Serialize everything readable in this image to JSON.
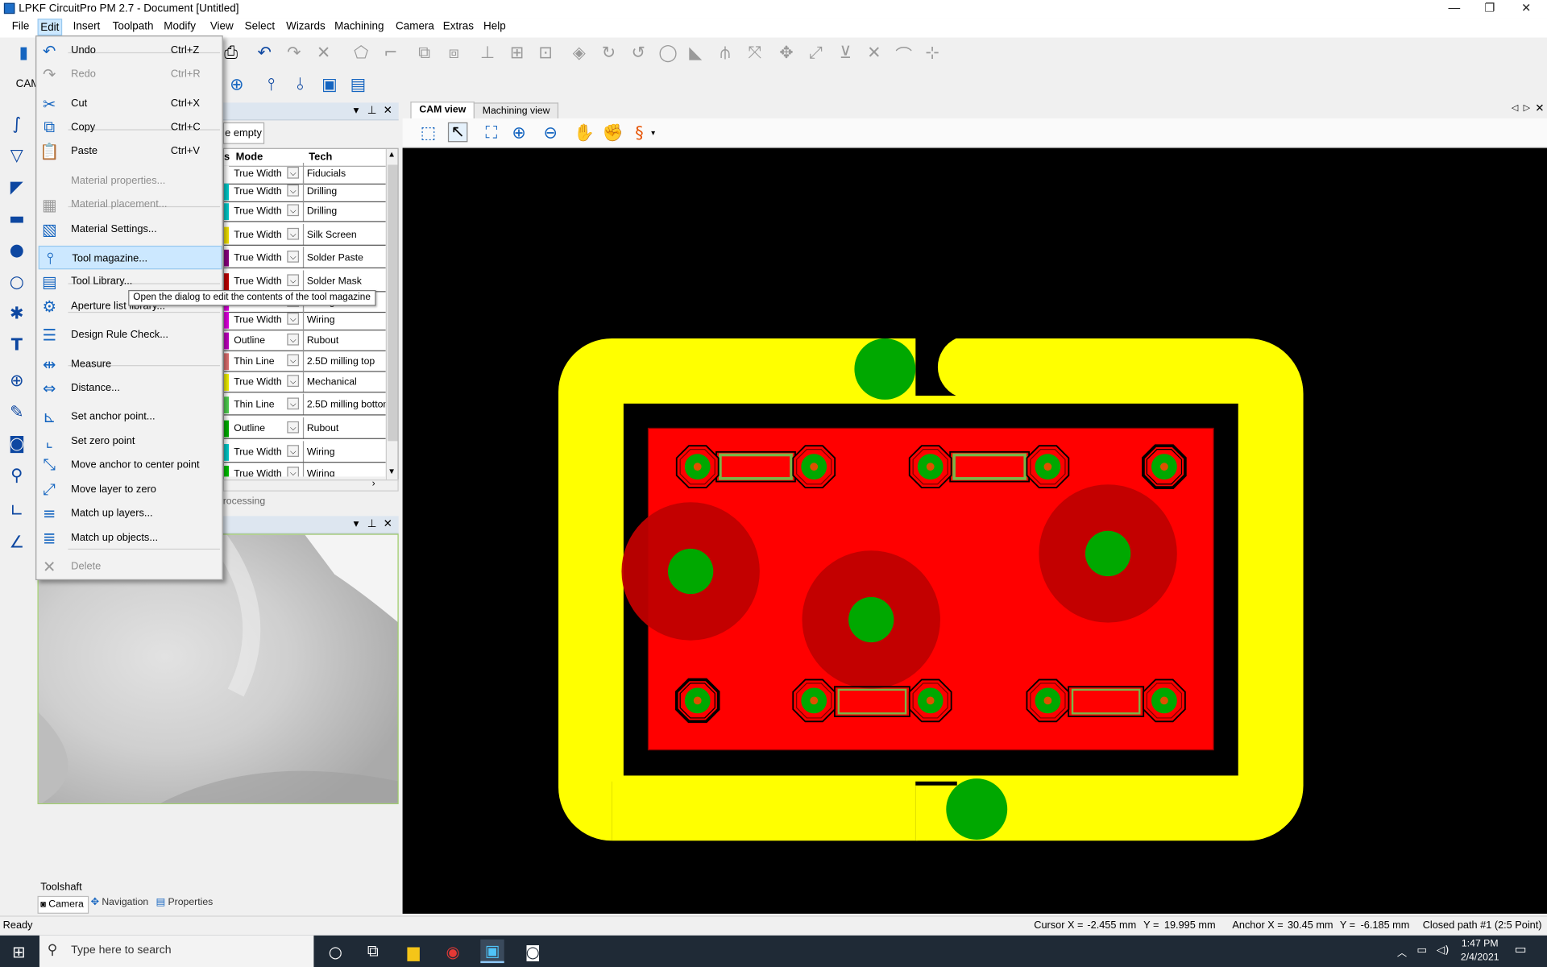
{
  "window": {
    "title": "LPKF CircuitPro PM 2.7 - Document [Untitled]"
  },
  "menubar": {
    "items": [
      "File",
      "Edit",
      "Insert",
      "Toolpath",
      "Modify",
      "View",
      "Select",
      "Wizards",
      "Machining",
      "Camera",
      "Extras",
      "Help"
    ]
  },
  "edit_menu": {
    "items": [
      {
        "label": "Undo",
        "shortcut": "Ctrl+Z",
        "icon": "undo-icon",
        "disabled": false
      },
      {
        "label": "Redo",
        "shortcut": "Ctrl+R",
        "icon": "redo-icon",
        "disabled": true
      },
      {
        "label": "Cut",
        "shortcut": "Ctrl+X",
        "icon": "cut-icon",
        "disabled": false
      },
      {
        "label": "Copy",
        "shortcut": "Ctrl+C",
        "icon": "copy-icon",
        "disabled": false
      },
      {
        "label": "Paste",
        "shortcut": "Ctrl+V",
        "icon": "paste-icon",
        "disabled": false
      },
      {
        "label": "Material properties...",
        "shortcut": "",
        "icon": "",
        "disabled": true
      },
      {
        "label": "Material placement...",
        "shortcut": "",
        "icon": "material-placement-icon",
        "disabled": true
      },
      {
        "label": "Material Settings...",
        "shortcut": "",
        "icon": "material-settings-icon",
        "disabled": false
      },
      {
        "label": "Tool magazine...",
        "shortcut": "",
        "icon": "tool-magazine-icon",
        "disabled": false,
        "selected": true
      },
      {
        "label": "Tool Library...",
        "shortcut": "",
        "icon": "tool-library-icon",
        "disabled": false
      },
      {
        "label": "Aperture list library...",
        "shortcut": "",
        "icon": "aperture-icon",
        "disabled": false
      },
      {
        "label": "Design Rule Check...",
        "shortcut": "",
        "icon": "drc-icon",
        "disabled": false
      },
      {
        "label": "Measure",
        "shortcut": "",
        "icon": "measure-icon",
        "disabled": false
      },
      {
        "label": "Distance...",
        "shortcut": "",
        "icon": "distance-icon",
        "disabled": false
      },
      {
        "label": "Set anchor point...",
        "shortcut": "",
        "icon": "anchor-icon",
        "disabled": false
      },
      {
        "label": "Set zero point",
        "shortcut": "",
        "icon": "zero-point-icon",
        "disabled": false
      },
      {
        "label": "Move anchor to center point",
        "shortcut": "",
        "icon": "move-anchor-icon",
        "disabled": false
      },
      {
        "label": "Move layer to zero",
        "shortcut": "",
        "icon": "move-layer-icon",
        "disabled": false
      },
      {
        "label": "Match up layers...",
        "shortcut": "",
        "icon": "match-layers-icon",
        "disabled": false
      },
      {
        "label": "Match up objects...",
        "shortcut": "",
        "icon": "match-objects-icon",
        "disabled": false
      },
      {
        "label": "Delete",
        "shortcut": "",
        "icon": "delete-icon",
        "disabled": true
      }
    ]
  },
  "tooltip": "Open the dialog to edit the contents of the tool magazine",
  "cam_label": "CAM",
  "layers_panel": {
    "empty_button": "e empty",
    "columns": [
      "s",
      "Mode",
      "Tech"
    ],
    "rows": [
      {
        "mode": "True Width",
        "tech": "Fiducials",
        "color": "#ffffff"
      },
      {
        "mode": "True Width",
        "tech": "Drilling",
        "color": "#00c8c8"
      },
      {
        "mode": "True Width",
        "tech": "Drilling",
        "color": "#00c8c8"
      },
      {
        "mode": "True Width",
        "tech": "Silk Screen",
        "color": "#f0e000"
      },
      {
        "mode": "True Width",
        "tech": "Solder Paste",
        "color": "#8a0080"
      },
      {
        "mode": "True Width",
        "tech": "Solder Mask",
        "color": "#c00000"
      },
      {
        "mode": "True Width",
        "tech": "Wiring",
        "color": "#e000e0"
      },
      {
        "mode": "True Width",
        "tech": "Wiring",
        "color": "#e000e0"
      },
      {
        "mode": "Outline",
        "tech": "Rubout",
        "color": "#c000c0"
      },
      {
        "mode": "Thin Line",
        "tech": "2.5D milling top",
        "color": "#e07070"
      },
      {
        "mode": "True Width",
        "tech": "Mechanical",
        "color": "#f0f000"
      },
      {
        "mode": "Thin Line",
        "tech": "2.5D milling bottom",
        "color": "#50d050"
      },
      {
        "mode": "Outline",
        "tech": "Rubout",
        "color": "#00b000"
      },
      {
        "mode": "True Width",
        "tech": "Wiring",
        "color": "#00c8c8"
      },
      {
        "mode": "True Width",
        "tech": "Wiring",
        "color": "#00c000"
      }
    ],
    "processing_label": "rocessing"
  },
  "toolshaft": {
    "label": "Toolshaft",
    "tabs": [
      "Camera",
      "Navigation",
      "Properties"
    ]
  },
  "cam_tabs": [
    "CAM view",
    "Machining view"
  ],
  "status": {
    "ready": "Ready",
    "cursor_x_label": "Cursor X =",
    "cursor_x": "-2.455 mm",
    "cursor_y_label": "Y =",
    "cursor_y": "19.995 mm",
    "anchor_x_label": "Anchor X =",
    "anchor_x": "30.45 mm",
    "anchor_y_label": "Y =",
    "anchor_y": "-6.185 mm",
    "path": "Closed path #1 (2:5 Point)"
  },
  "taskbar": {
    "search_placeholder": "Type here to search",
    "time": "1:47 PM",
    "date": "2/4/2021"
  },
  "colors": {
    "yellow": "#ffff00",
    "red": "#ff0000",
    "dark_red": "#c00000",
    "green": "#00a800",
    "black": "#000000",
    "selection": "#cce8ff"
  }
}
